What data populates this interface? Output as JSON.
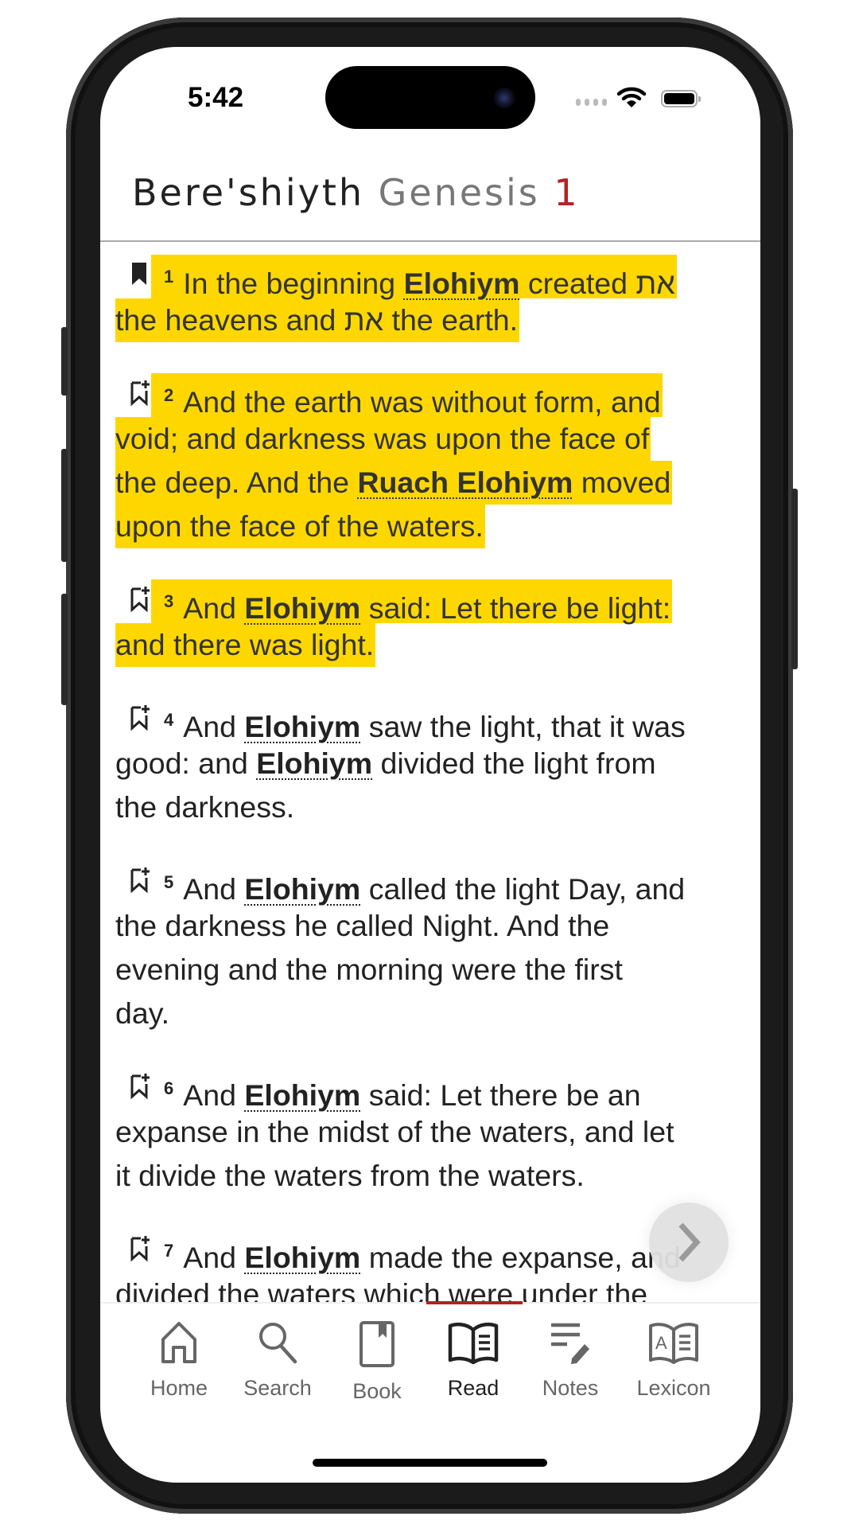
{
  "status_bar": {
    "time": "5:42"
  },
  "header": {
    "hebrew_name": "Bere'shiyth",
    "english_name": "Genesis",
    "chapter": "1"
  },
  "colors": {
    "highlight": "#FFD700",
    "accent": "#B22222"
  },
  "verses": [
    {
      "num": "1",
      "bookmarked": true,
      "highlighted": true,
      "lines": [
        [
          {
            "t": "In the beginning "
          },
          {
            "t": "Elohiym",
            "lex": true
          },
          {
            "t": " created את"
          }
        ],
        [
          {
            "t": "the heavens and את the earth."
          }
        ]
      ]
    },
    {
      "num": "2",
      "bookmarked": false,
      "highlighted": true,
      "lines": [
        [
          {
            "t": "And the earth was without form, and"
          }
        ],
        [
          {
            "t": "void; and darkness was upon the face of"
          }
        ],
        [
          {
            "t": "the deep. And the "
          },
          {
            "t": "Ruach Elohiym",
            "lex": true
          },
          {
            "t": " moved"
          }
        ],
        [
          {
            "t": "upon the face of the waters."
          }
        ]
      ]
    },
    {
      "num": "3",
      "bookmarked": false,
      "highlighted": true,
      "lines": [
        [
          {
            "t": "And "
          },
          {
            "t": "Elohiym",
            "lex": true
          },
          {
            "t": " said: Let there be light:"
          }
        ],
        [
          {
            "t": "and there was light."
          }
        ]
      ]
    },
    {
      "num": "4",
      "bookmarked": false,
      "highlighted": false,
      "lines": [
        [
          {
            "t": "And "
          },
          {
            "t": "Elohiym",
            "lex": true
          },
          {
            "t": " saw the light, that it was"
          }
        ],
        [
          {
            "t": "good: and "
          },
          {
            "t": "Elohiym",
            "lex": true
          },
          {
            "t": " divided the light from"
          }
        ],
        [
          {
            "t": "the darkness."
          }
        ]
      ]
    },
    {
      "num": "5",
      "bookmarked": false,
      "highlighted": false,
      "lines": [
        [
          {
            "t": "And "
          },
          {
            "t": "Elohiym",
            "lex": true
          },
          {
            "t": " called the light Day, and"
          }
        ],
        [
          {
            "t": "the darkness he called Night. And the"
          }
        ],
        [
          {
            "t": "evening and the morning were the first"
          }
        ],
        [
          {
            "t": "day."
          }
        ]
      ]
    },
    {
      "num": "6",
      "bookmarked": false,
      "highlighted": false,
      "lines": [
        [
          {
            "t": "And "
          },
          {
            "t": "Elohiym",
            "lex": true
          },
          {
            "t": " said: Let there be an"
          }
        ],
        [
          {
            "t": "expanse in the midst of the waters, and let"
          }
        ],
        [
          {
            "t": "it divide the waters from the waters."
          }
        ]
      ]
    },
    {
      "num": "7",
      "bookmarked": false,
      "highlighted": false,
      "lines": [
        [
          {
            "t": "And "
          },
          {
            "t": "Elohiym",
            "lex": true
          },
          {
            "t": " made the expanse, and"
          }
        ],
        [
          {
            "t": "divided the waters which were under the"
          }
        ]
      ]
    }
  ],
  "next_button": {
    "icon": "chevron-right-icon"
  },
  "tabs": [
    {
      "label": "Home",
      "icon": "home-icon",
      "active": false
    },
    {
      "label": "Search",
      "icon": "search-icon",
      "active": false
    },
    {
      "label": "Book",
      "icon": "book-icon",
      "active": false
    },
    {
      "label": "Read",
      "icon": "open-book-icon",
      "active": true
    },
    {
      "label": "Notes",
      "icon": "notes-icon",
      "active": false
    },
    {
      "label": "Lexicon",
      "icon": "lexicon-icon",
      "active": false
    }
  ]
}
